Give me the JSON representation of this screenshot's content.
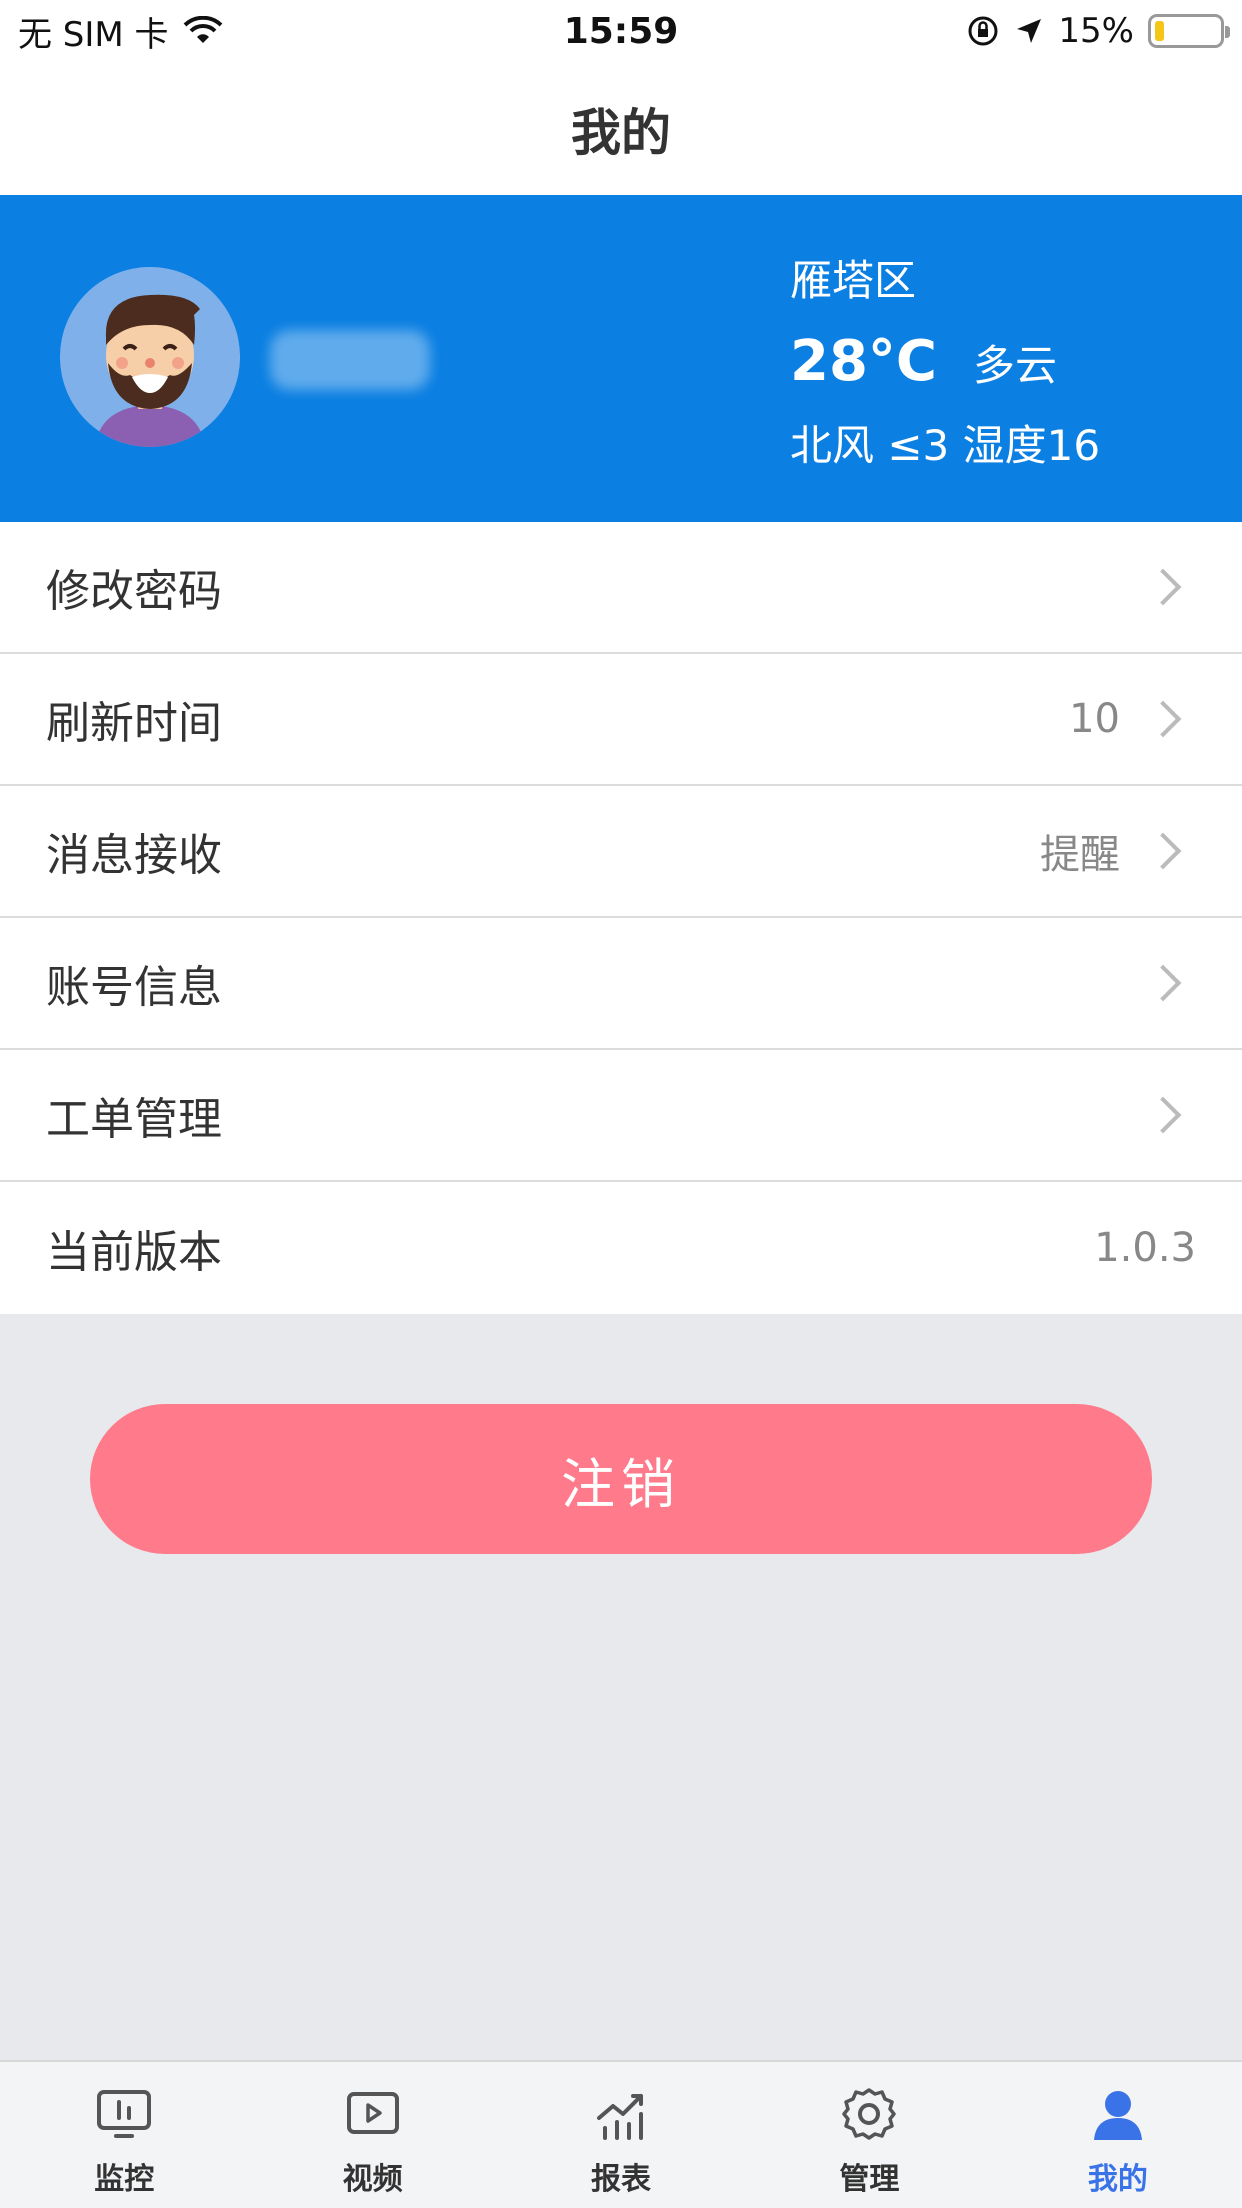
{
  "status_bar": {
    "carrier": "无 SIM 卡",
    "time": "15:59",
    "battery_text": "15%",
    "battery_level": 0.15
  },
  "header": {
    "title": "我的"
  },
  "profile": {
    "weather": {
      "district": "雁塔区",
      "temperature": "28°C",
      "condition": "多云",
      "wind_humidity": "北风 ≤3 湿度16"
    }
  },
  "settings": [
    {
      "label": "修改密码",
      "value": ""
    },
    {
      "label": "刷新时间",
      "value": "10"
    },
    {
      "label": "消息接收",
      "value": "提醒"
    },
    {
      "label": "账号信息",
      "value": ""
    },
    {
      "label": "工单管理",
      "value": ""
    },
    {
      "label": "当前版本",
      "value": "1.0.3"
    }
  ],
  "logout_label": "注销",
  "tabbar": {
    "items": [
      {
        "label": "监控",
        "icon": "monitor-icon"
      },
      {
        "label": "视频",
        "icon": "video-icon"
      },
      {
        "label": "报表",
        "icon": "chart-icon"
      },
      {
        "label": "管理",
        "icon": "gear-icon"
      },
      {
        "label": "我的",
        "icon": "user-icon"
      }
    ],
    "active_color": "#3a72e8"
  },
  "colors": {
    "header_bg": "#0b7fe2",
    "logout_bg": "#ff7a8a",
    "page_bg": "#e7e9ed"
  }
}
